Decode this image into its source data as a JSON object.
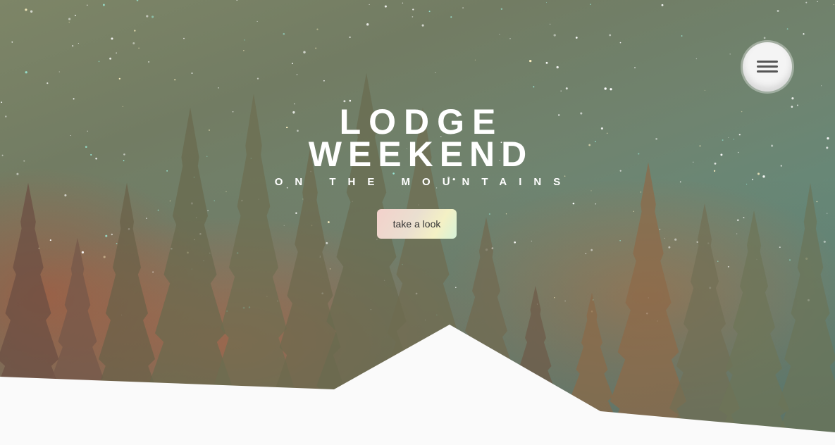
{
  "hero": {
    "title_line1": "LODGE",
    "title_line2": "WEEKEND",
    "subtitle": "ON THE MOUNTAINS",
    "cta_label": "take a look"
  },
  "menu": {
    "icon": "hamburger-menu-icon"
  },
  "colors": {
    "title_text": "#ffffff",
    "cta_text": "#333333",
    "ground": "#fafafa",
    "menu_button_bg": "#f4f4f4",
    "menu_icon": "#555555"
  }
}
